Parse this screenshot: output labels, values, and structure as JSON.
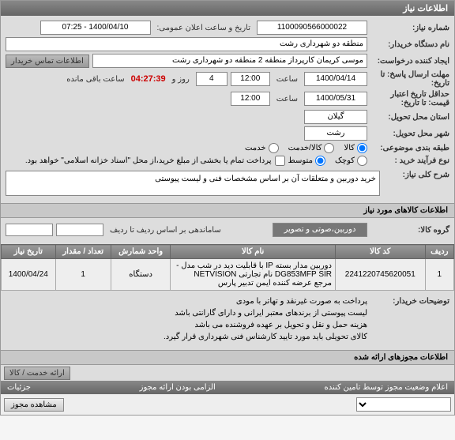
{
  "header": {
    "title": "اطلاعات نیاز"
  },
  "form": {
    "need_no_label": "شماره نیاز:",
    "need_no": "1100090566000022",
    "announce_label": "تاریخ و ساعت اعلان عمومی:",
    "announce_value": "1400/04/10 - 07:25",
    "buyer_org_label": "نام دستگاه خریدار:",
    "buyer_org": "منطقه دو شهرداری رشت",
    "creator_label": "ایجاد کننده درخواست:",
    "creator": "موسی کریمان کارپرداز منطقه 2 منطقه دو شهرداری رشت",
    "contact_link": "اطلاعات تماس خریدار",
    "deadline_label": "مهلت ارسال پاسخ: تا تاریخ:",
    "deadline_date": "1400/04/14",
    "time_label": "ساعت",
    "deadline_time": "12:00",
    "days_left": "4",
    "days_label": "روز و",
    "countdown": "04:27:39",
    "remaining_label": "ساعت باقی مانده",
    "validity_label": "حداقل تاریخ اعتبار قیمت: تا تاریخ:",
    "validity_date": "1400/05/31",
    "validity_time": "12:00",
    "delivery_province_label": "استان محل تحویل:",
    "delivery_province": "گیلان",
    "delivery_city_label": "شهر محل تحویل:",
    "delivery_city": "رشت",
    "classification_label": "طبقه بندی موضوعی:",
    "type_goods": "کالا",
    "type_service": "کالا/خدمت",
    "type_svc": "خدمت",
    "process_type_label": "نوع فرآیند خرید :",
    "process_small": "کوچک",
    "process_medium": "متوسط",
    "payment_note": "پرداخت تمام یا بخشی از مبلغ خرید،از محل \"اسناد خزانه اسلامی\" خواهد بود.",
    "summary_label": "شرح کلی نیاز:",
    "summary": "خرید دوربین و متعلقات آن بر اساس مشخصات فنی و لیست پیوستی"
  },
  "items_section": {
    "title": "اطلاعات کالاهای مورد نیاز",
    "group_label": "گروه کالا:",
    "group_value": "دوربین،صوتی و تصویر"
  },
  "table": {
    "headers": {
      "row": "ردیف",
      "code": "کد کالا",
      "name": "نام کالا",
      "unit": "واحد شمارش",
      "qty": "تعداد / مقدار",
      "need_date": "تاریخ نیاز"
    },
    "rows": [
      {
        "row": "1",
        "code": "2241220745620051",
        "name": "دوربین مدار بسته IP با قابلیت دید در شب مدل -DG853MFP SIR نام تجارتی NETVISION مرجع عرضه کننده ایمن تدبیر پارس",
        "unit": "دستگاه",
        "qty": "1",
        "need_date": "1400/04/24"
      }
    ]
  },
  "buyer_notes": {
    "label": "توضیحات خریدار:",
    "lines": [
      "پرداخت به صورت غیرنقد و تهاتر با مودی",
      "لیست پیوستی از برندهای معتبر ایرانی و دارای گارانتی باشد",
      "هزینه حمل و نقل و تحویل بر عهده فروشنده می باشد",
      "کالای تحویلی باید مورد تایید کارشناس فنی شهرداری قرار گیرد."
    ]
  },
  "bottom": {
    "permit_section": "اطلاعات مجوزهای ارائه شده",
    "tab_goods_service": "ارائه خدمت / کالا",
    "status_title": "اعلام وضعیت مجوز توسط تامین کننده",
    "mandatory_label": "الزامی بودن ارائه مجوز",
    "details_label": "جزئیات",
    "view_permit": "مشاهده مجوز"
  }
}
